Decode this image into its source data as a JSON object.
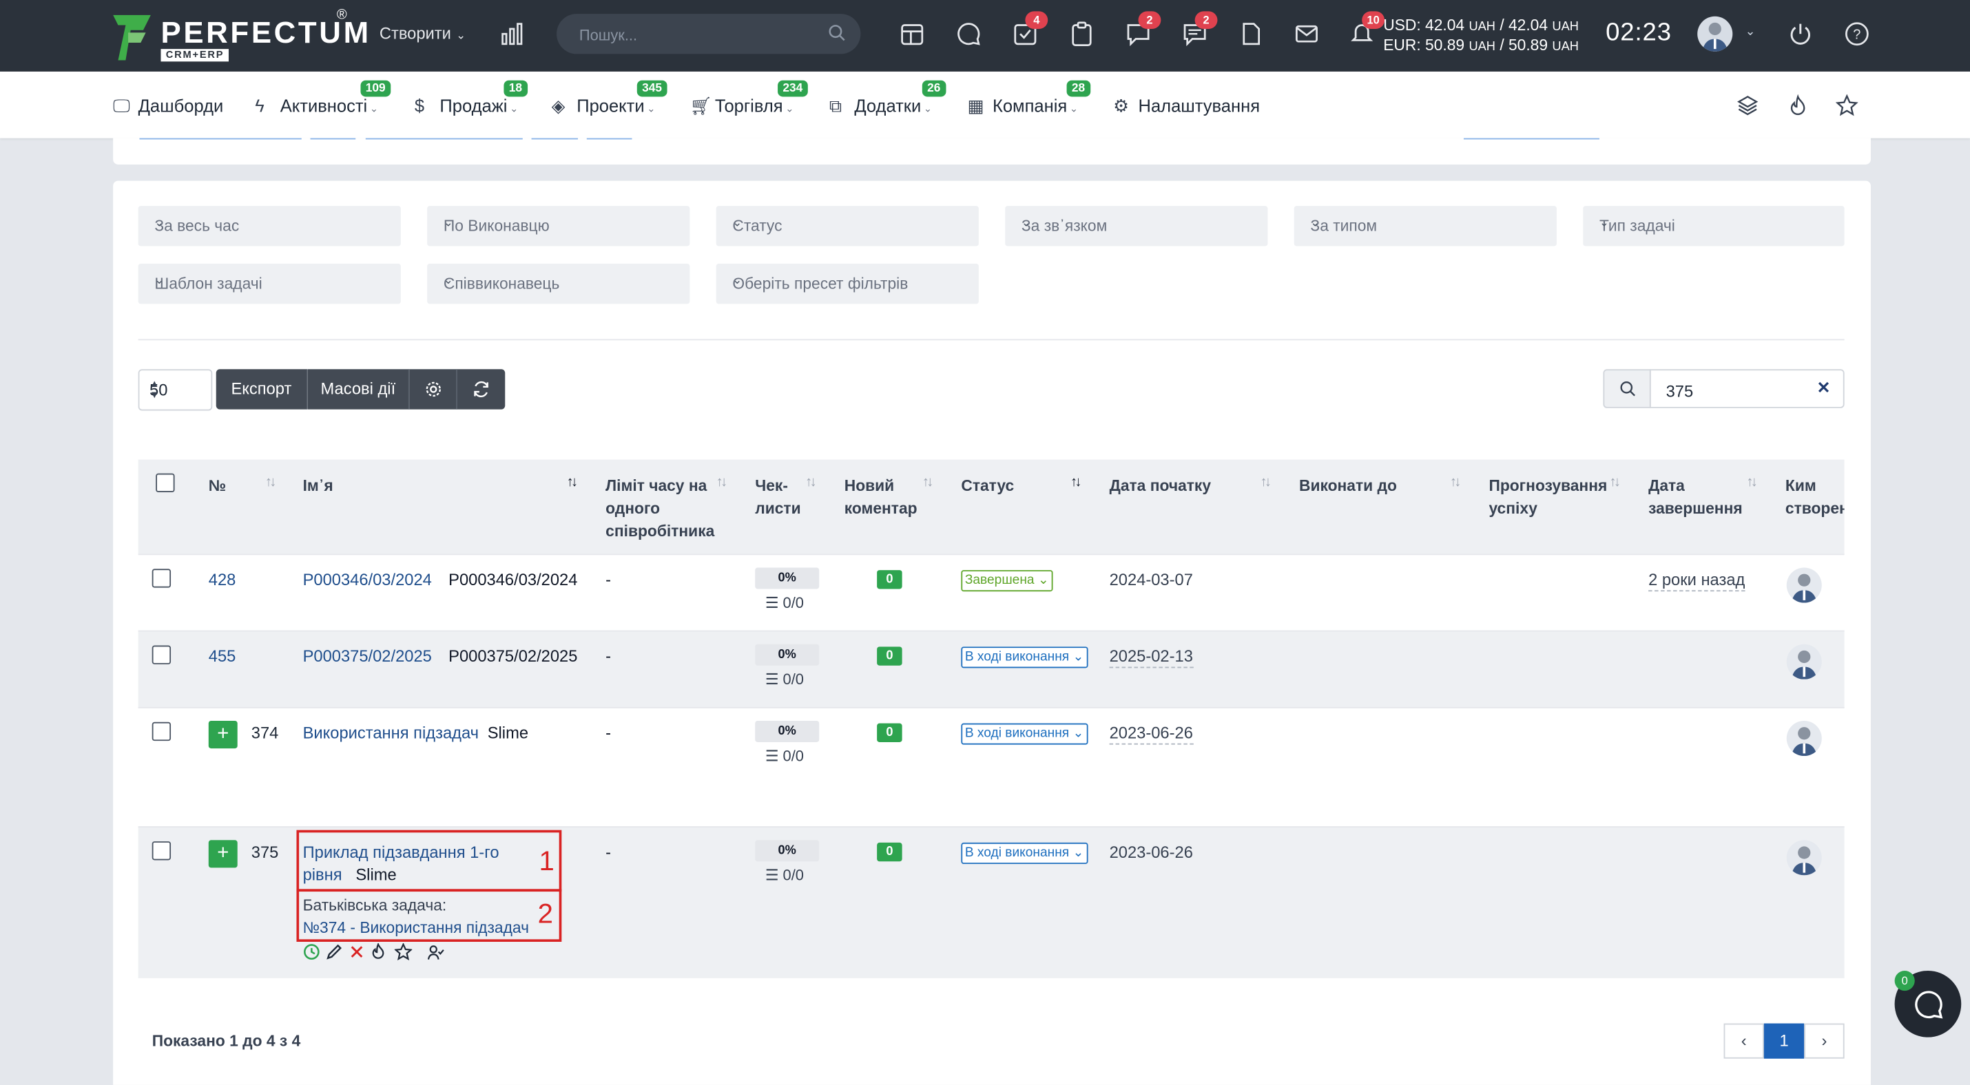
{
  "topbar": {
    "logo_text": "PERFECTUM",
    "logo_reg": "®",
    "logo_sub": "CRM+ERP",
    "create_label": "Створити",
    "search_placeholder": "Пошук...",
    "badges": {
      "tasks": "4",
      "messages": "2",
      "discussions": "2",
      "notifications": "10"
    },
    "fx_usd": "USD: 42.04",
    "fx_usd_mid": " / 42.04",
    "fx_eur": "EUR: 50.89",
    "fx_eur_mid": " / 50.89",
    "fx_unit": "UAH",
    "clock": "02:23"
  },
  "nav": {
    "items": [
      {
        "label": "Дашборди"
      },
      {
        "label": "Активності",
        "badge": "109"
      },
      {
        "label": "Продажі",
        "badge": "18"
      },
      {
        "label": "Проекти",
        "badge": "345"
      },
      {
        "label": "Торгівля",
        "badge": "234"
      },
      {
        "label": "Додатки",
        "badge": "26"
      },
      {
        "label": "Компанія",
        "badge": "28"
      },
      {
        "label": "Налаштування"
      }
    ]
  },
  "filters": {
    "period": "За весь час",
    "assignee": "По Виконавцю",
    "status": "Статус",
    "relation": "За зв᾽язком",
    "type": "За типом",
    "task_type": "Тип задачі",
    "template": "Шаблон задачі",
    "coassignee": "Співвиконавець",
    "preset": "Оберіть пресет фільтрів"
  },
  "toolbar": {
    "page_size": "50",
    "export_label": "Експорт",
    "bulk_label": "Масові дії",
    "search_value": "375"
  },
  "table": {
    "headers": {
      "num": "№",
      "name": "Ім᾽я",
      "limit_l1": "Ліміт часу на",
      "limit_l2": "одного",
      "limit_l3": "співробітника",
      "check_l1": "Чек-",
      "check_l2": "листи",
      "comment_l1": "Новий",
      "comment_l2": "коментар",
      "status": "Статус",
      "start": "Дата початку",
      "due": "Виконати до",
      "forecast_l1": "Прогнозування",
      "forecast_l2": "успіху",
      "finish_l1": "Дата",
      "finish_l2": "завершення",
      "creator_l1": "Ким",
      "creator_l2": "створено"
    },
    "rows": [
      {
        "id": "428",
        "name": "P000346/03/2024",
        "relation": "P000346/03/2024",
        "limit": "-",
        "pct": "0%",
        "checks": "0/0",
        "comments": "0",
        "status": "Завершена",
        "start": "2024-03-07",
        "finished": "2 роки назад"
      },
      {
        "id": "455",
        "name": "P000375/02/2025",
        "relation": "P000375/02/2025",
        "limit": "-",
        "pct": "0%",
        "checks": "0/0",
        "comments": "0",
        "status": "В ході виконання",
        "start": "2025-02-13"
      },
      {
        "id": "374",
        "name": "Використання підзадач",
        "relation": "Slime",
        "limit": "-",
        "pct": "0%",
        "checks": "0/0",
        "comments": "0",
        "status": "В ході виконання",
        "start": "2023-06-26"
      },
      {
        "id": "375",
        "name_l1": "Приклад підзавдання 1-го",
        "name_l2": "рівня",
        "relation": "Slime",
        "parent_label": "Батьківська задача:",
        "parent_link": "№374 - Використання підзадач",
        "limit": "-",
        "pct": "0%",
        "checks": "0/0",
        "comments": "0",
        "status": "В ході виконання",
        "start": "2023-06-26"
      }
    ],
    "annotations": {
      "box1": "1",
      "box2": "2"
    }
  },
  "footer": {
    "summary": "Показано 1 до 4 з 4",
    "current_page": "1",
    "chat_badge": "0"
  },
  "colors": {
    "topbar": "#2b323b",
    "green": "#2ea44f",
    "red_badge": "#e0424f",
    "link": "#1f4e8c",
    "annotation": "#d92323",
    "primary": "#1e63b8"
  }
}
